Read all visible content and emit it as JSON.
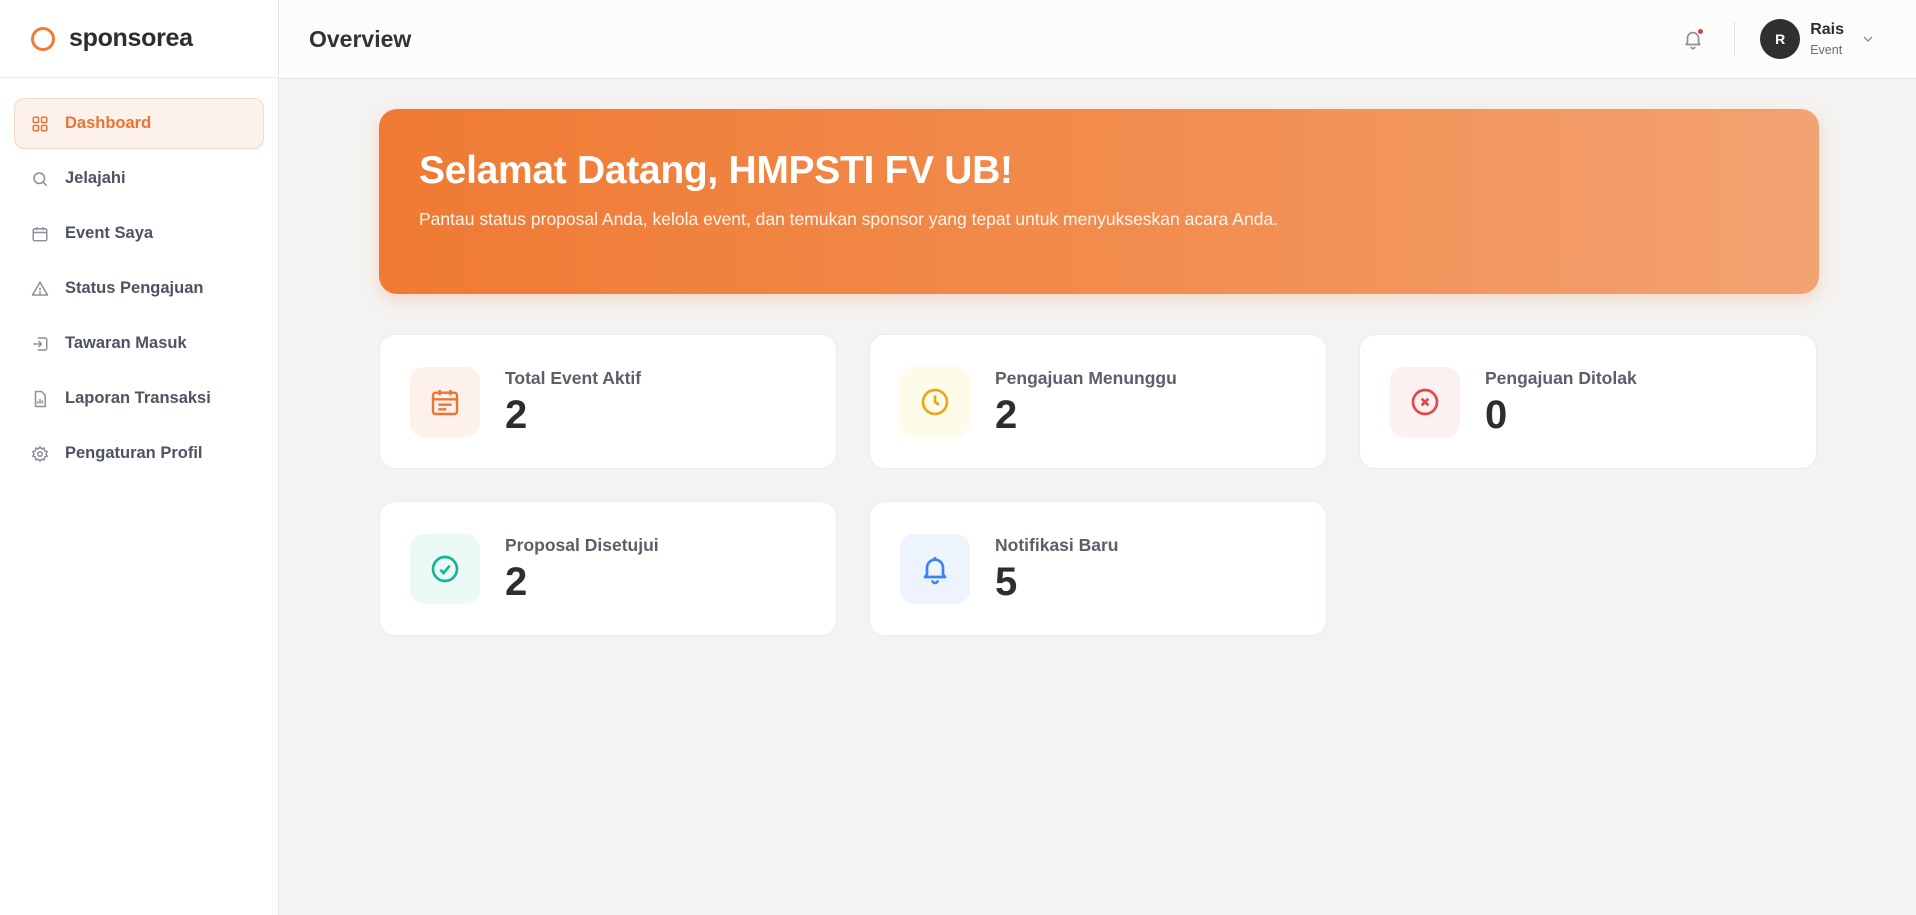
{
  "brand": {
    "name": "sponsorea",
    "accent": "#f07d33"
  },
  "sidebar": {
    "items": [
      {
        "label": "Dashboard",
        "icon": "grid-icon",
        "active": true
      },
      {
        "label": "Jelajahi",
        "icon": "search-icon"
      },
      {
        "label": "Event Saya",
        "icon": "calendar-icon"
      },
      {
        "label": "Status Pengajuan",
        "icon": "warning-icon"
      },
      {
        "label": "Tawaran Masuk",
        "icon": "inbox-icon"
      },
      {
        "label": "Laporan Transaksi",
        "icon": "file-chart-icon"
      },
      {
        "label": "Pengaturan Profil",
        "icon": "gear-icon"
      }
    ]
  },
  "header": {
    "title": "Overview",
    "notification_icon": "bell-icon",
    "user": {
      "initial": "R",
      "name": "Rais",
      "role": "Event"
    }
  },
  "hero": {
    "title": "Selamat Datang, HMPSTI FV UB!",
    "subtitle": "Pantau status proposal Anda, kelola event, dan temukan sponsor yang tepat untuk menyukseskan acara Anda."
  },
  "stats": [
    {
      "label": "Total Event Aktif",
      "value": "2",
      "icon": "calendar-icon",
      "color": "#ea7434",
      "bg": "#fdf1ec"
    },
    {
      "label": "Pengajuan Menunggu",
      "value": "2",
      "icon": "clock-icon",
      "color": "#e8a71c",
      "bg": "#fefbe8"
    },
    {
      "label": "Pengajuan Ditolak",
      "value": "0",
      "icon": "x-circle-icon",
      "color": "#e04848",
      "bg": "#fdf0f0"
    },
    {
      "label": "Proposal Disetujui",
      "value": "2",
      "icon": "check-circle-icon",
      "color": "#18b39b",
      "bg": "#ecfaf6"
    },
    {
      "label": "Notifikasi Baru",
      "value": "5",
      "icon": "bell-icon",
      "color": "#3b82f6",
      "bg": "#eef4fe"
    }
  ]
}
